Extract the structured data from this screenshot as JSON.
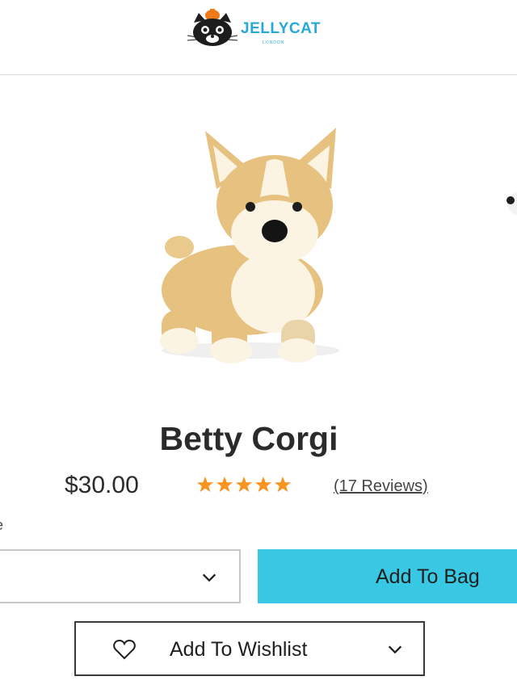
{
  "header": {
    "brand": "JELLYCAT",
    "brand_sub": "LONDON"
  },
  "gallery": {
    "main_image": "corgi-plush-image",
    "next_image": "partial-next-image"
  },
  "product": {
    "title": "Betty Corgi",
    "price": "$30.00",
    "rating": 5,
    "rating_max": 5,
    "reviews_label": "(17 Reviews)",
    "size_label_fragment": "e"
  },
  "actions": {
    "size_select_value": "",
    "add_to_bag": "Add To Bag",
    "add_to_wishlist": "Add To Wishlist"
  },
  "colors": {
    "accent": "#39c8e3",
    "brand": "#27a8d6",
    "star": "#f7931e",
    "text": "#2b2b2b"
  },
  "icons": {
    "logo": "jellycat-cat-logo",
    "star": "star-icon",
    "chevron": "chevron-down-icon",
    "heart": "heart-outline-icon"
  }
}
